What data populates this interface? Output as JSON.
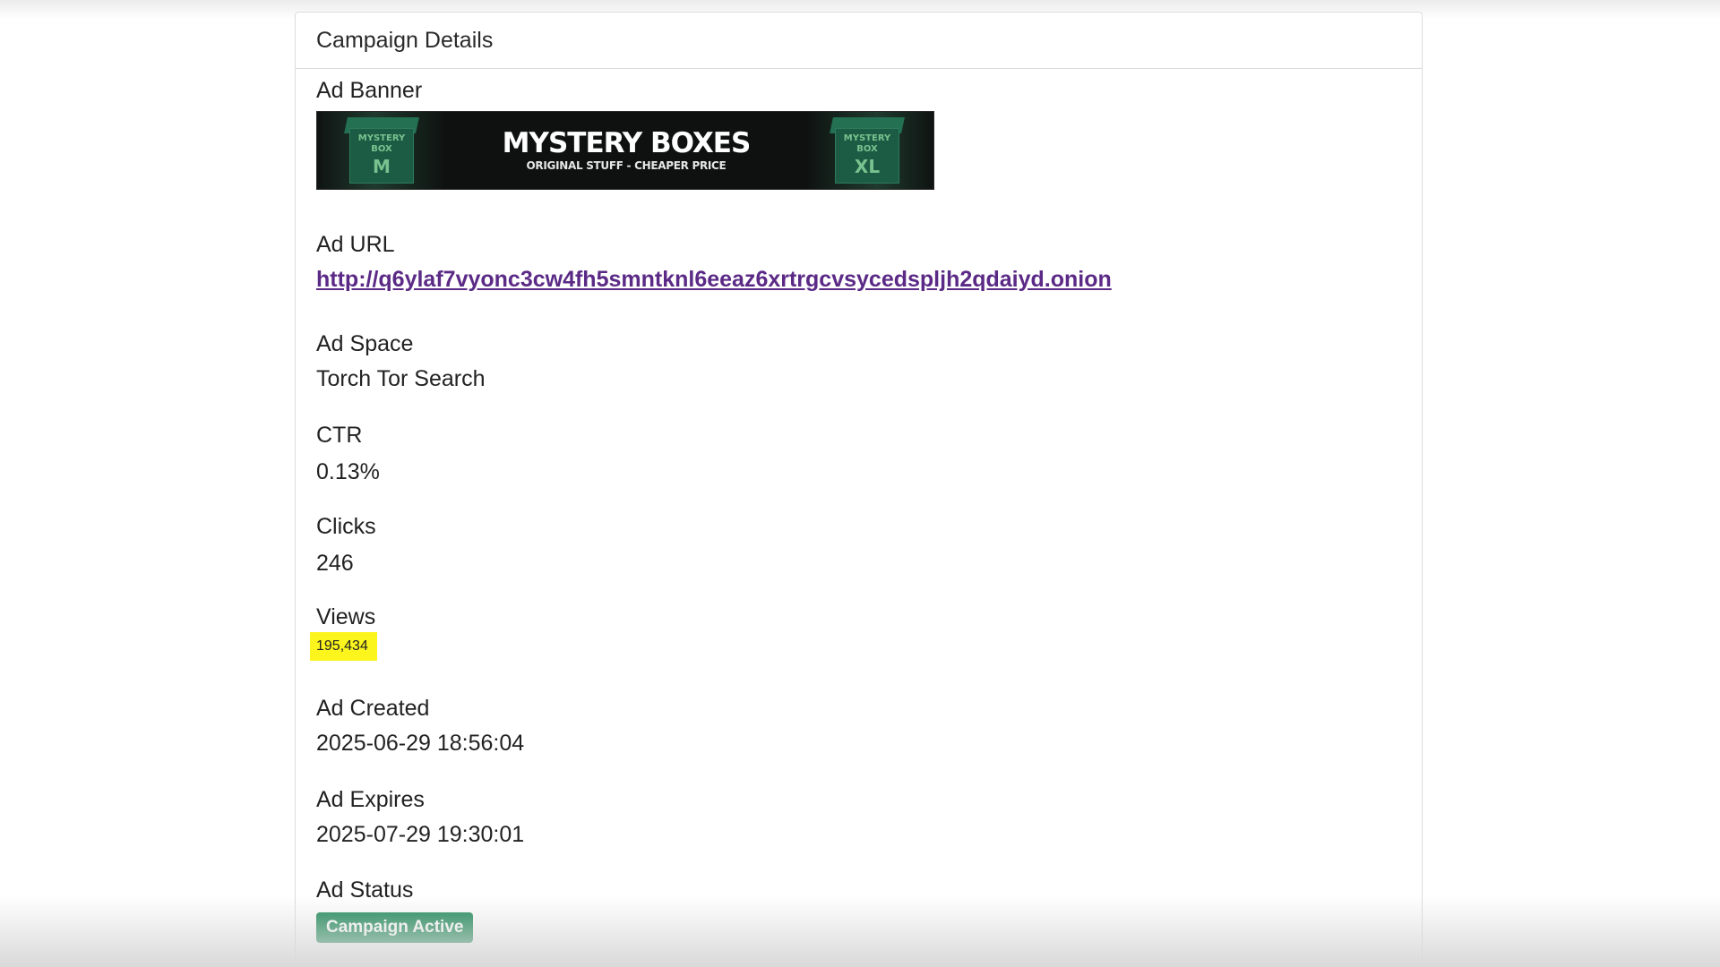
{
  "card": {
    "title": "Campaign Details"
  },
  "banner": {
    "label": "Ad Banner",
    "title": "MYSTERY BOXES",
    "subtitle": "ORIGINAL STUFF - CHEAPER PRICE",
    "left_box": {
      "line1": "MYSTERY",
      "line2": "BOX",
      "size": "M"
    },
    "right_box": {
      "line1": "MYSTERY",
      "line2": "BOX",
      "size": "XL"
    }
  },
  "ad_url": {
    "label": "Ad URL",
    "value": "http://q6ylaf7vyonc3cw4fh5smntknl6eeaz6xrtrgcvsycedspljh2qdaiyd.onion"
  },
  "ad_space": {
    "label": "Ad Space",
    "value": "Torch Tor Search"
  },
  "ctr": {
    "label": "CTR",
    "value": "0.13%"
  },
  "clicks": {
    "label": "Clicks",
    "value": "246"
  },
  "views": {
    "label": "Views",
    "value": "195,434",
    "highlight_color": "#fbf51d"
  },
  "ad_created": {
    "label": "Ad Created",
    "value": "2025-06-29 18:56:04"
  },
  "ad_expires": {
    "label": "Ad Expires",
    "value": "2025-07-29 19:30:01"
  },
  "ad_status": {
    "label": "Ad Status",
    "value": "Campaign Active",
    "color": "#198754"
  }
}
